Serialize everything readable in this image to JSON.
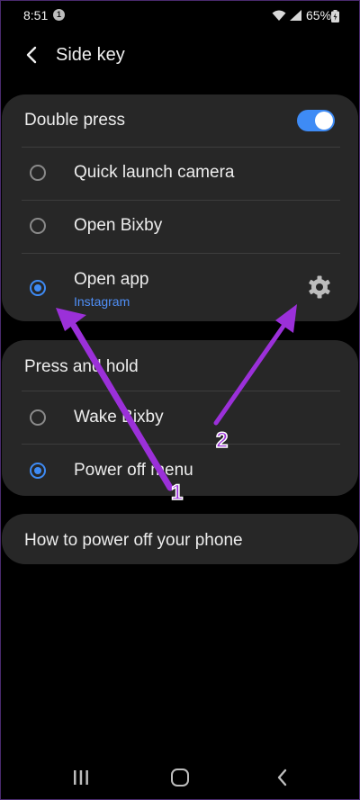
{
  "status_bar": {
    "time": "8:51",
    "notification_count": "1",
    "battery": "65%"
  },
  "header": {
    "title": "Side key"
  },
  "double_press": {
    "title": "Double press",
    "enabled": true,
    "options": [
      {
        "label": "Quick launch camera",
        "selected": false
      },
      {
        "label": "Open Bixby",
        "selected": false
      },
      {
        "label": "Open app",
        "sublabel": "Instagram",
        "selected": true
      }
    ]
  },
  "press_and_hold": {
    "title": "Press and hold",
    "options": [
      {
        "label": "Wake Bixby",
        "selected": false
      },
      {
        "label": "Power off menu",
        "selected": true
      }
    ]
  },
  "power_off_link": {
    "label": "How to power off your phone"
  },
  "annotations": [
    {
      "label": "1"
    },
    {
      "label": "2"
    }
  ],
  "colors": {
    "accent": "#3e8bf5",
    "card_bg": "#272727",
    "background": "#000000",
    "annotation": "#9b30d9"
  }
}
